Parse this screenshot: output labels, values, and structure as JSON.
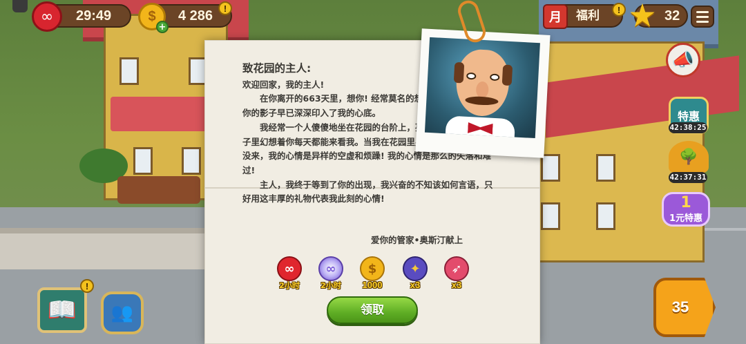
{
  "hud": {
    "lives_timer": "29:49",
    "coins": "4 286",
    "bonus_label": "福利",
    "stars": "32"
  },
  "side": {
    "special_label": "特惠",
    "special_timer": "42:38:25",
    "tree_timer": "42:37:31",
    "offer_number": "1",
    "offer_label": "1元特惠",
    "level": "35"
  },
  "letter": {
    "title": "致花园的主人:",
    "greeting": "欢迎回家，我的主人!",
    "para1": "在你离开的663天里，想你! 经常莫名的想你! 或许你的影子早已深深印入了我的心底。",
    "para2": "我经常一个人傻傻地坐在花园的台阶上，孤独的弹着吉他，脑子里幻想着你每天都能来看我。当我在花园里晃荡很久，发现你还没来，我的心情是异样的空虚和烦躁! 我的心情是那么的失落和难过!",
    "para3": "主人，我终于等到了你的出现，我兴奋的不知该如何言语，只好用这丰厚的礼物代表我此刻的心情!",
    "signature": "爱你的管家•奥斯汀献上"
  },
  "rewards": [
    {
      "name": "infinite-lives",
      "label": "2小时"
    },
    {
      "name": "infinite-booster",
      "label": "2小时"
    },
    {
      "name": "coins",
      "label": "1000"
    },
    {
      "name": "bomb-booster",
      "label": "x3"
    },
    {
      "name": "rocket-booster",
      "label": "x3"
    }
  ],
  "claim_label": "领取",
  "icons": {
    "heart": "heart-icon",
    "coin": "coin-icon",
    "star": "star-icon",
    "menu": "menu-icon",
    "megaphone": "megaphone-icon",
    "journal": "journal-icon",
    "team": "team-icon",
    "play": "play-icon"
  },
  "colors": {
    "letter_bg": "#f1ede3",
    "claim_green": "#5fae25",
    "hud_brown": "#6b4426",
    "reward_label": "#ffd22b"
  }
}
